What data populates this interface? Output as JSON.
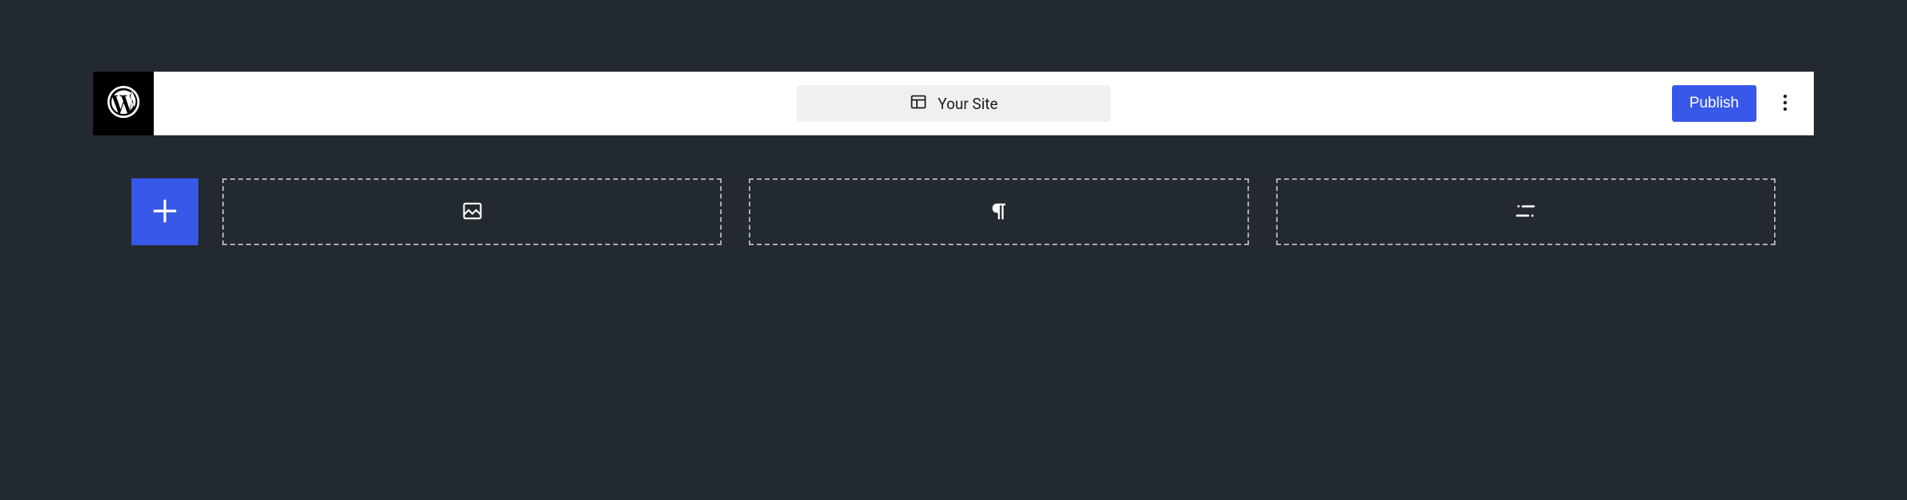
{
  "topbar": {
    "logo_name": "wordpress-logo",
    "site_label": "Your Site",
    "publish_label": "Publish",
    "options_name": "more-options"
  },
  "toolbar": {
    "add_block_name": "add-block"
  },
  "blocks": [
    {
      "type": "image",
      "icon_name": "image-icon"
    },
    {
      "type": "paragraph",
      "icon_name": "paragraph-icon"
    },
    {
      "type": "list",
      "icon_name": "list-icon"
    }
  ],
  "colors": {
    "accent": "#3858e9",
    "bg_dark": "#232931",
    "topbar_bg": "#ffffff",
    "logo_bg": "#000000",
    "chip_bg": "#f0f0f0",
    "dash_border": "#a9adb2"
  }
}
